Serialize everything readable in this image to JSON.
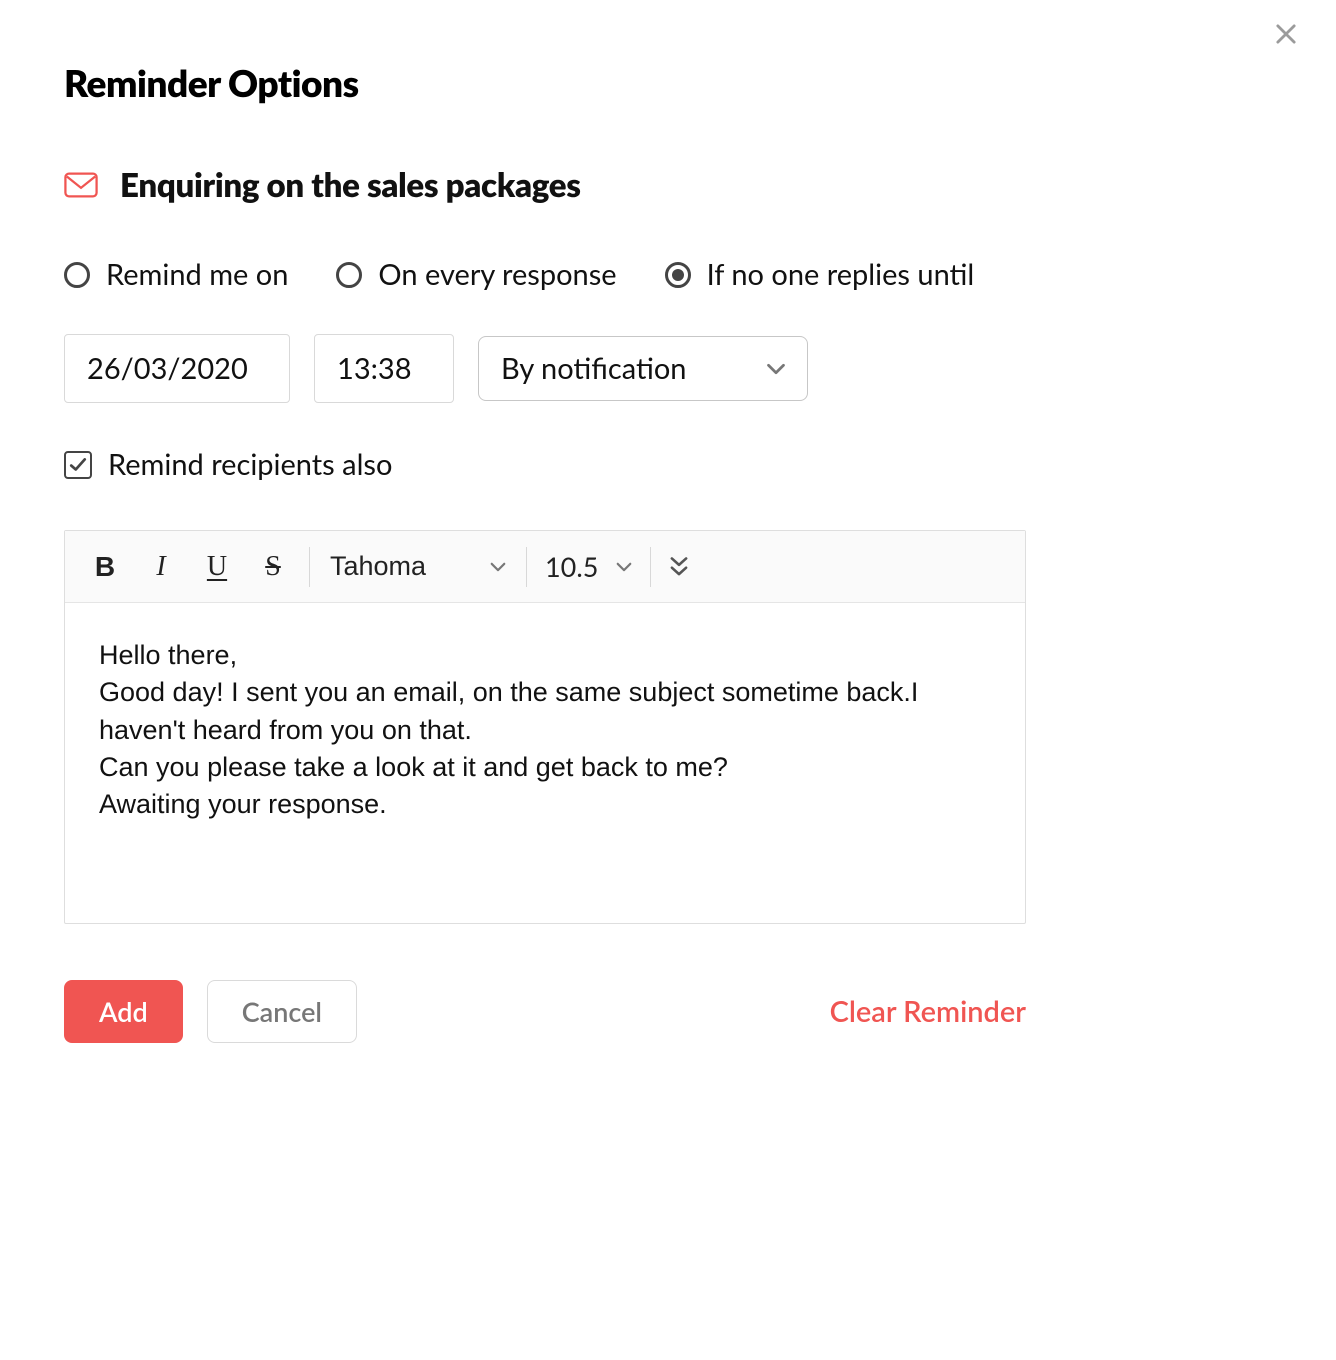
{
  "dialog": {
    "title": "Reminder Options",
    "subject": "Enquiring on the sales packages"
  },
  "radios": {
    "remind_me_on": "Remind me on",
    "on_every_response": "On every response",
    "if_no_one_replies": "If no one replies until",
    "selected": "if_no_one_replies"
  },
  "fields": {
    "date": "26/03/2020",
    "time": "13:38",
    "method": "By notification"
  },
  "checkbox": {
    "remind_recipients": "Remind recipients also",
    "checked": true
  },
  "toolbar": {
    "bold": "B",
    "italic": "I",
    "underline": "U",
    "strike": "S",
    "font": "Tahoma",
    "size": "10.5"
  },
  "body_text": "Hello there,\nGood day! I sent you an email, on the same subject sometime back.I haven't heard from you on that.\nCan you please take a look at it and get back to me?\nAwaiting your response.",
  "footer": {
    "add": "Add",
    "cancel": "Cancel",
    "clear": "Clear Reminder"
  }
}
